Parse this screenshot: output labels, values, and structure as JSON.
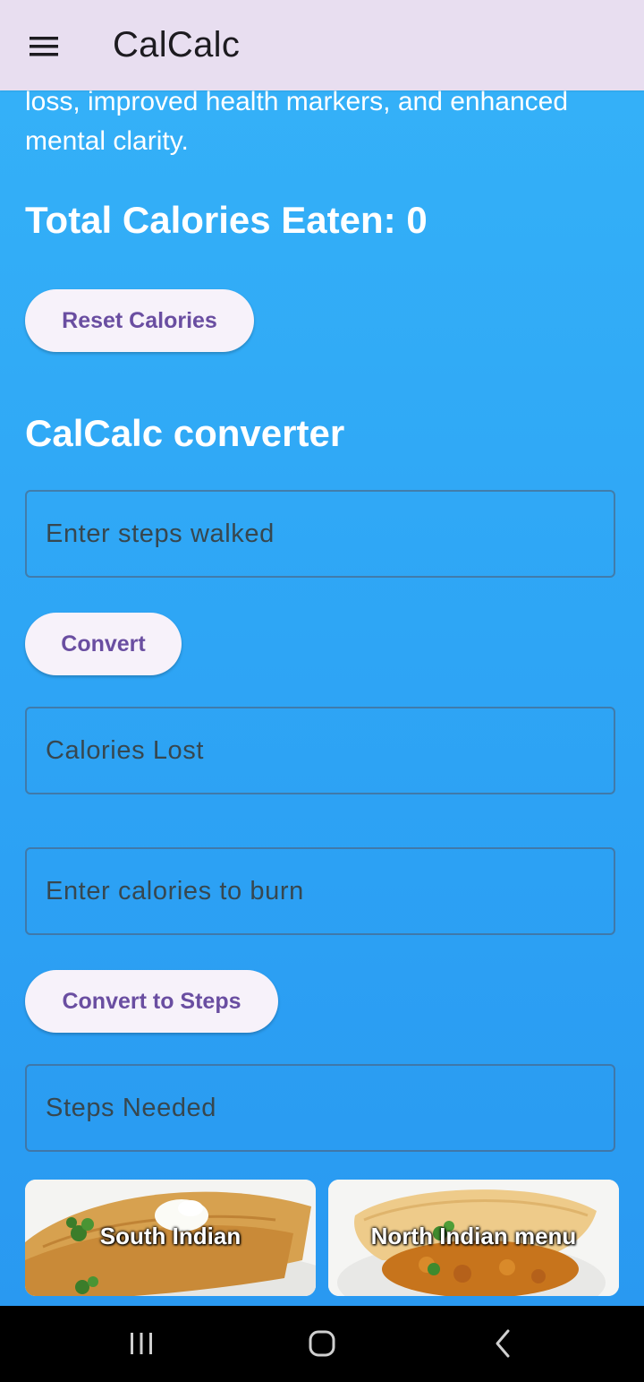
{
  "appbar": {
    "title": "CalCalc"
  },
  "intro": {
    "text": "loss, improved health markers, and enhanced mental clarity."
  },
  "totals": {
    "label": "Total Calories Eaten: 0"
  },
  "buttons": {
    "reset": "Reset Calories",
    "convert": "Convert",
    "convert_steps": "Convert to Steps"
  },
  "converter": {
    "title": "CalCalc converter",
    "steps_placeholder": "Enter steps walked",
    "calories_lost_label": "Calories Lost",
    "calories_placeholder": "Enter calories to burn",
    "steps_needed_label": "Steps Needed"
  },
  "cards": [
    {
      "label": "South Indian"
    },
    {
      "label": "North Indian menu"
    }
  ],
  "colors": {
    "background_top": "#35b2f8",
    "background_bottom": "#2999f1",
    "appbar": "#e8def0",
    "button_bg": "#f7f2fa",
    "button_text": "#6a4ea1"
  }
}
